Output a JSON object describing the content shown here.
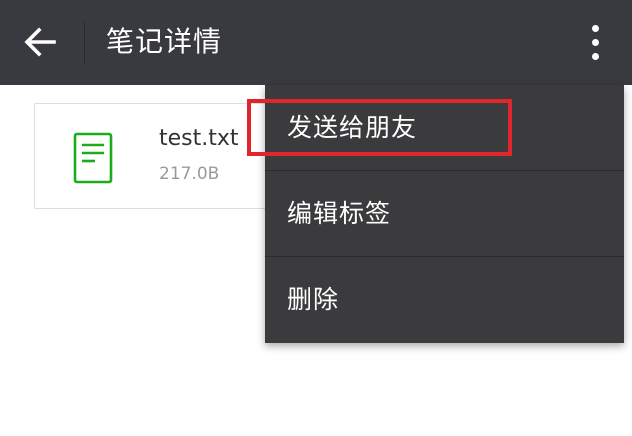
{
  "app_bar": {
    "title": "笔记详情",
    "back_icon": "arrow-left-icon",
    "more_icon": "more-vertical-icon",
    "background_color": "#393a3f"
  },
  "file_card": {
    "icon": "document-icon",
    "icon_color": "#1aad19",
    "file_name": "test.txt",
    "file_size": "217.0B"
  },
  "menu": {
    "background_color": "#3b3b3d",
    "items": [
      {
        "label": "发送给朋友",
        "highlighted": true
      },
      {
        "label": "编辑标签",
        "highlighted": false
      },
      {
        "label": "删除",
        "highlighted": false
      }
    ]
  },
  "highlight": {
    "color": "#e0262c"
  }
}
